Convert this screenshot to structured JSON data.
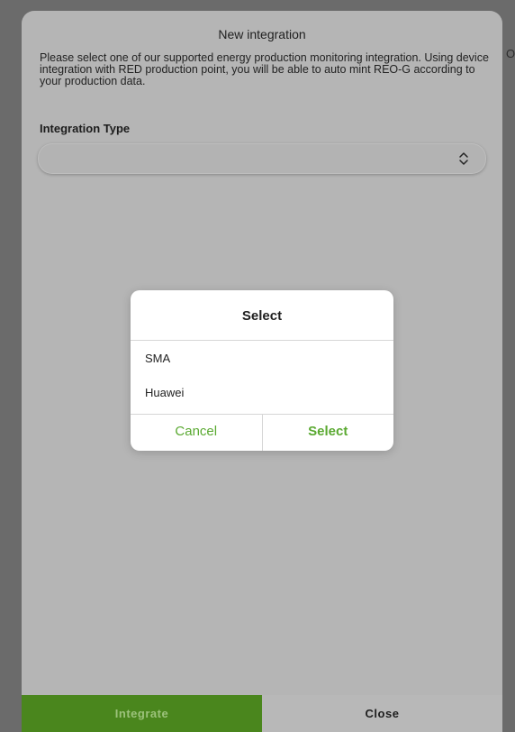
{
  "background_edge": {
    "partial_text": "O"
  },
  "modal": {
    "title": "New integration",
    "description": "Please select one of our supported energy production monitoring integration. Using device integration with RED production point, you will be able to auto mint REO-G according to your production data.",
    "integration_type_label": "Integration Type",
    "select_value": "",
    "select_icon": "up-down-chevron-icon",
    "footer": {
      "integrate_label": "Integrate",
      "close_label": "Close"
    }
  },
  "picker_dialog": {
    "title": "Select",
    "options": [
      "SMA",
      "Huawei"
    ],
    "cancel_label": "Cancel",
    "select_label": "Select"
  },
  "colors": {
    "accent_green": "#5aa931",
    "integrate_bg": "#4a861d"
  }
}
